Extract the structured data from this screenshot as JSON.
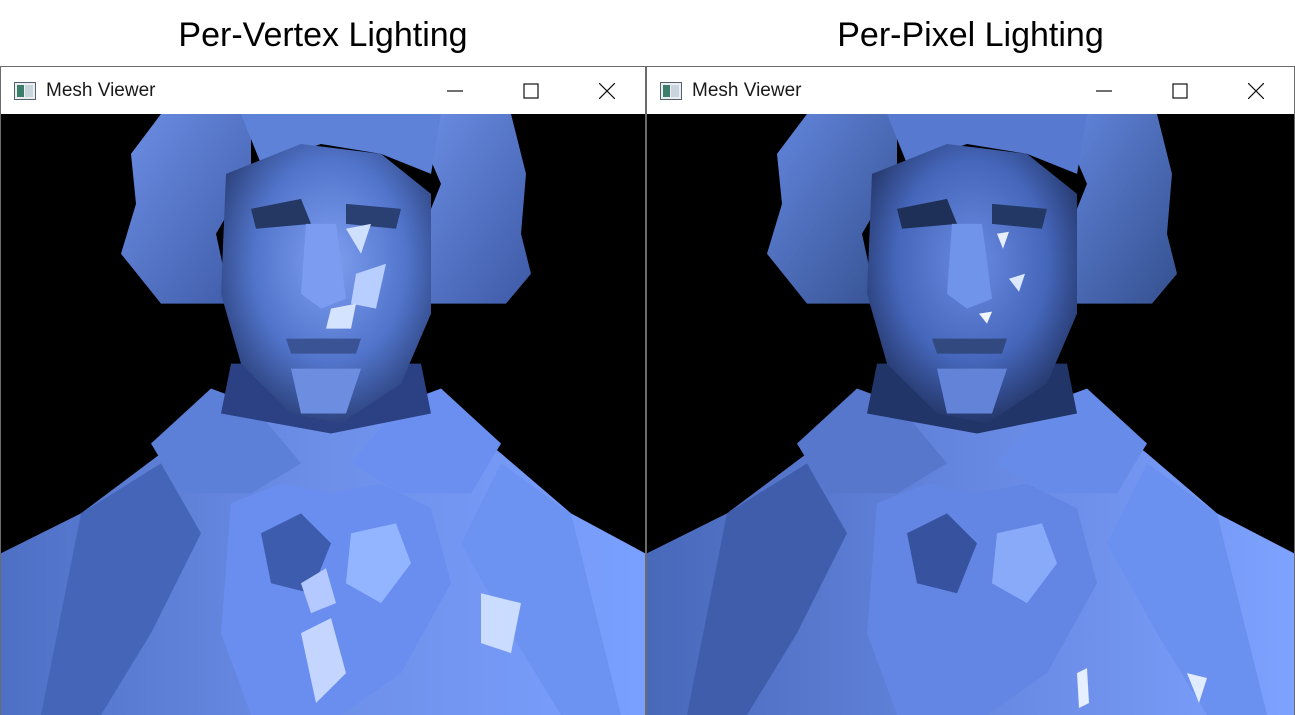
{
  "panels": [
    {
      "caption": "Per-Vertex Lighting",
      "window": {
        "title": "Mesh Viewer",
        "controls": {
          "minimize_icon": "minimize-icon",
          "maximize_icon": "maximize-icon",
          "close_icon": "close-icon"
        },
        "app_icon": "window-app-icon"
      }
    },
    {
      "caption": "Per-Pixel Lighting",
      "window": {
        "title": "Mesh Viewer",
        "controls": {
          "minimize_icon": "minimize-icon",
          "maximize_icon": "maximize-icon",
          "close_icon": "close-icon"
        },
        "app_icon": "window-app-icon"
      }
    }
  ],
  "colors": {
    "mesh_base": "#5b80d6",
    "mesh_shadow": "#22335e",
    "mesh_highlight": "#c6d8ff",
    "background": "#000000",
    "titlebar": "#ffffff"
  }
}
